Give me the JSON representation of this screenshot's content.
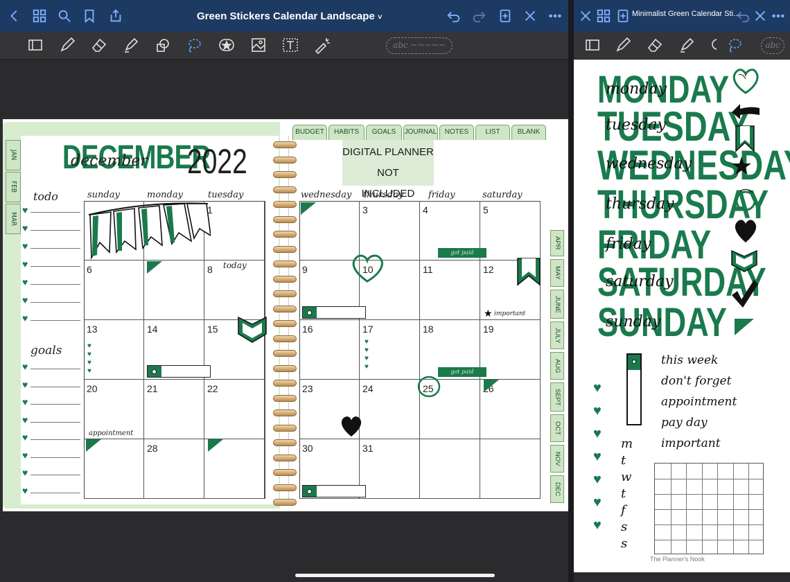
{
  "left_window": {
    "title": "Green Stickers Calendar Landscape",
    "title_chevron": "˅",
    "handwriting_box": "abc ~~~~~"
  },
  "right_window": {
    "title": "Minimalist Green Calendar Sti...",
    "handwriting_box": "abc"
  },
  "planner": {
    "month_title": "DECEMBER",
    "month_script": "december",
    "year": "2022",
    "todo_label": "todo",
    "goals_label": "goals",
    "notice_line1": "DIGITAL PLANNER NOT",
    "notice_line2": "INCLUDED",
    "left_tabs": [
      "JAN",
      "FEB",
      "MAR"
    ],
    "top_tabs": [
      "BUDGET",
      "HABITS",
      "GOALS",
      "JOURNAL",
      "NOTES",
      "LIST",
      "BLANK"
    ],
    "right_tabs": [
      "APR",
      "MAY",
      "JUNE",
      "JULY",
      "AUG",
      "SEPT",
      "OCT",
      "NOV",
      "DEC"
    ],
    "day_names": [
      "sunday",
      "monday",
      "tuesday",
      "wednesday",
      "thursday",
      "friday",
      "saturday"
    ],
    "weeks": [
      [
        "",
        "",
        "",
        "",
        "",
        "",
        ""
      ],
      [
        "",
        "",
        "1",
        "",
        "3",
        "4",
        "5"
      ],
      [
        "6",
        "",
        "8",
        "9",
        "10",
        "11",
        "12"
      ],
      [
        "13",
        "14",
        "15",
        "16",
        "17",
        "18",
        "19"
      ],
      [
        "20",
        "21",
        "22",
        "23",
        "24",
        "25",
        "26"
      ],
      [
        "",
        "28",
        "",
        "30",
        "31",
        "",
        ""
      ]
    ],
    "stickers": {
      "today": "today",
      "important": "important",
      "got_paid_1": "got paid",
      "got_paid_2": "got paid",
      "appointment": "appointment"
    }
  },
  "sticker_sheet": {
    "days": [
      {
        "bold": "MONDAY",
        "script": "monday"
      },
      {
        "bold": "TUESDAY",
        "script": "tuesday"
      },
      {
        "bold": "WEDNESDAY",
        "script": "wednesday"
      },
      {
        "bold": "THURSDAY",
        "script": "thursday"
      },
      {
        "bold": "FRIDAY",
        "script": "friday"
      },
      {
        "bold": "SATURDAY",
        "script": "saturday"
      },
      {
        "bold": "SUNDAY",
        "script": "sunday"
      }
    ],
    "phrases": [
      "this week",
      "don't forget",
      "appointment",
      "pay day",
      "important"
    ],
    "letters": [
      "m",
      "t",
      "w",
      "t",
      "f",
      "s",
      "s"
    ],
    "credit": "The Planner's Nook"
  },
  "colors": {
    "accent_green": "#1a7a4c",
    "tab_green": "#cfe6c6",
    "titlebar_blue": "#1d3a63",
    "icon_blue": "#7fb1ff"
  }
}
